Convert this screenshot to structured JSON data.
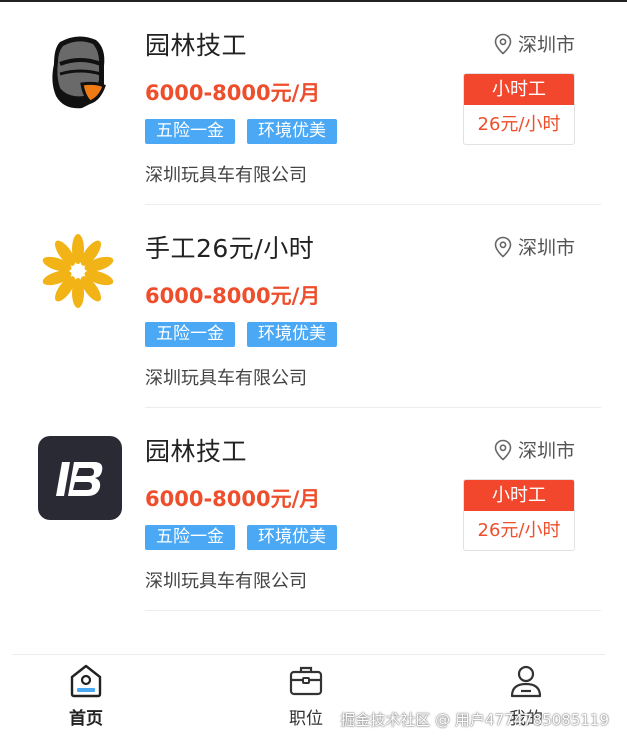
{
  "jobs": [
    {
      "title": "园林技工",
      "location": "深圳市",
      "salary": "6000-8000元/月",
      "tags": [
        "五险一金",
        "环境优美"
      ],
      "company": "深圳玩具车有限公司",
      "hourly": {
        "type": "小时工",
        "rate": "26元/小时"
      },
      "logo_icon": "helmet-logo-icon"
    },
    {
      "title": "手工26元/小时",
      "location": "深圳市",
      "salary": "6000-8000元/月",
      "tags": [
        "五险一金",
        "环境优美"
      ],
      "company": "深圳玩具车有限公司",
      "logo_icon": "flower-logo-icon"
    },
    {
      "title": "园林技工",
      "location": "深圳市",
      "salary": "6000-8000元/月",
      "tags": [
        "五险一金",
        "环境优美"
      ],
      "company": "深圳玩具车有限公司",
      "hourly": {
        "type": "小时工",
        "rate": "26元/小时"
      },
      "logo_icon": "ib-logo-icon"
    }
  ],
  "tabbar": {
    "home": "首页",
    "jobs": "职位",
    "mine": "我的"
  },
  "watermark": "掘金技术社区 @ 用户4774785085119",
  "colors": {
    "salary": "#ee4e2c",
    "tag": "#4aa8f5",
    "hourly_header": "#f2472d",
    "active_tab": "#4aa8f5"
  }
}
